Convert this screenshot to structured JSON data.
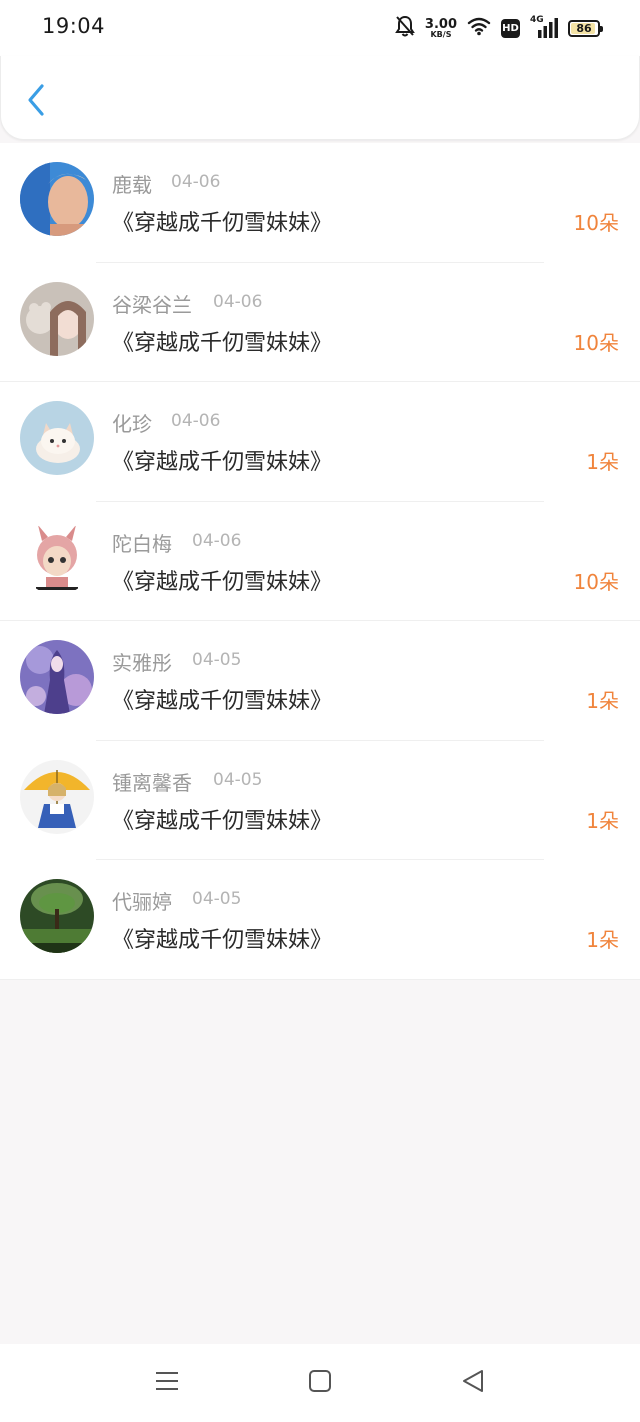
{
  "status_bar": {
    "time": "19:04",
    "speed_value": "3.00",
    "speed_unit": "KB/S",
    "hd_label": "HD",
    "network": "4G",
    "battery_level": "86",
    "icons": [
      "bell-muted-icon",
      "wifi-icon",
      "hd-icon",
      "signal-icon",
      "battery-icon"
    ]
  },
  "header": {
    "back_icon": "chevron-left-icon",
    "accent_color": "#3a9ee5"
  },
  "list": {
    "count_color": "#f0843c",
    "items": [
      {
        "name": "鹿载",
        "date": "04-06",
        "title": "《穿越成千仞雪妹妹》",
        "count": "10朵",
        "avatar": "avatar-man-photo"
      },
      {
        "name": "谷梁谷兰",
        "date": "04-06",
        "title": "《穿越成千仞雪妹妹》",
        "count": "10朵",
        "avatar": "avatar-girl-with-plush"
      },
      {
        "name": "化珍",
        "date": "04-06",
        "title": "《穿越成千仞雪妹妹》",
        "count": "1朵",
        "avatar": "avatar-kitten"
      },
      {
        "name": "陀白梅",
        "date": "04-06",
        "title": "《穿越成千仞雪妹妹》",
        "count": "10朵",
        "avatar": "avatar-cartoon-bunny-girl"
      },
      {
        "name": "实雅彤",
        "date": "04-05",
        "title": "《穿越成千仞雪妹妹》",
        "count": "1朵",
        "avatar": "avatar-purple-anime"
      },
      {
        "name": "锺离馨香",
        "date": "04-05",
        "title": "《穿越成千仞雪妹妹》",
        "count": "1朵",
        "avatar": "avatar-anime-umbrella-girl"
      },
      {
        "name": "代骊婷",
        "date": "04-05",
        "title": "《穿越成千仞雪妹妹》",
        "count": "1朵",
        "avatar": "avatar-green-tree"
      }
    ]
  },
  "nav_bar": {
    "icons": [
      "menu-icon",
      "home-square-icon",
      "back-triangle-icon"
    ]
  }
}
